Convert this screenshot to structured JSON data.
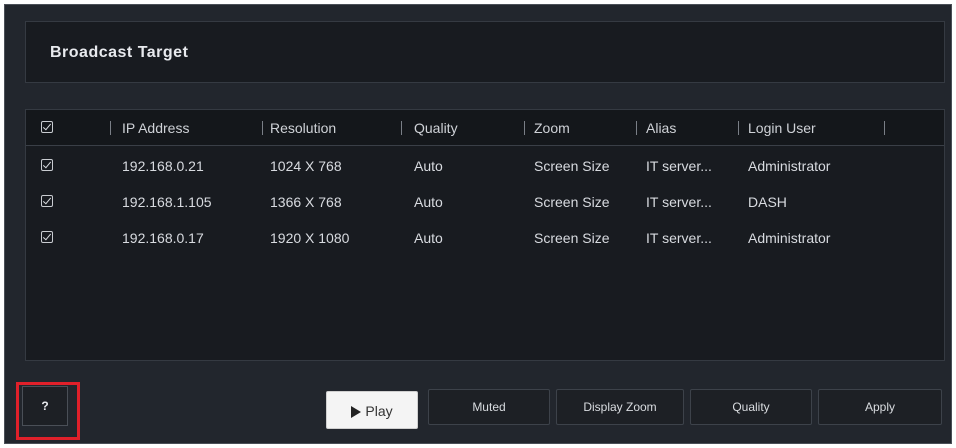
{
  "title": "Broadcast Target",
  "columns": [
    "IP Address",
    "Resolution",
    "Quality",
    "Zoom",
    "Alias",
    "Login User"
  ],
  "rows": [
    {
      "checked": true,
      "ip": "192.168.0.21",
      "resolution": "1024 X 768",
      "quality": "Auto",
      "zoom": "Screen Size",
      "alias": "IT server...",
      "login_user": "Administrator"
    },
    {
      "checked": true,
      "ip": "192.168.1.105",
      "resolution": "1366 X 768",
      "quality": "Auto",
      "zoom": "Screen Size",
      "alias": "IT server...",
      "login_user": "DASH"
    },
    {
      "checked": true,
      "ip": "192.168.0.17",
      "resolution": "1920 X 1080",
      "quality": "Auto",
      "zoom": "Screen Size",
      "alias": "IT server...",
      "login_user": "Administrator"
    }
  ],
  "toolbar": {
    "help_label": "?",
    "play_label": "Play",
    "muted_label": "Muted",
    "display_zoom_label": "Display Zoom",
    "quality_label": "Quality",
    "apply_label": "Apply"
  },
  "colors": {
    "window_bg": "#22262d",
    "panel_bg": "#181b20",
    "highlight": "#e0202a"
  }
}
